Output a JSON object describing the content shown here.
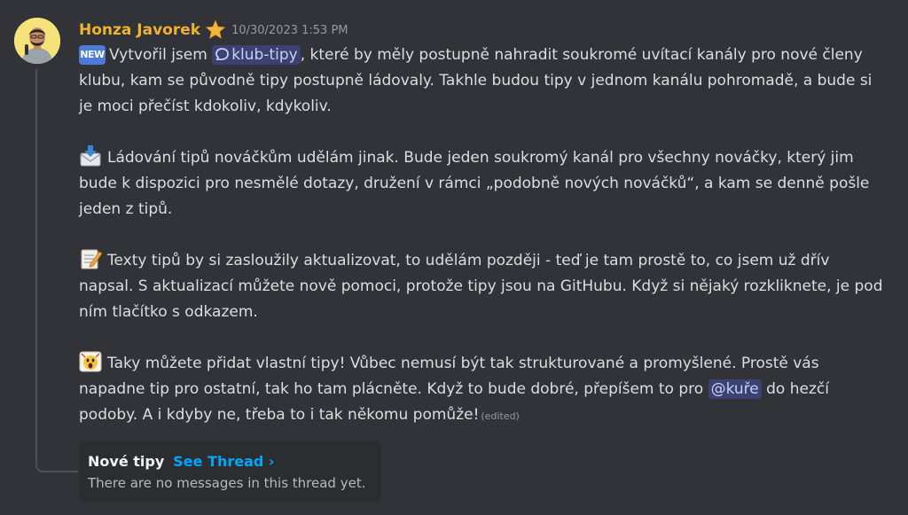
{
  "author": {
    "name": "Honza Javorek",
    "badge_icon": "star-icon",
    "timestamp": "10/30/2023 1:53 PM",
    "name_color": "#f0b232"
  },
  "paragraphs": [
    {
      "icon": "new-icon",
      "badge_text": "NEW",
      "before": "Vytvořil jsem ",
      "mention": "klub-tipy",
      "mention_icon": "thread-channel-icon",
      "after": ", které by měly postupně nahradit soukromé uvítací kanály pro nové členy klubu, kam se původně tipy postupně ládovaly. Takhle budou tipy v jednom kanálu pohromadě, a bude si je moci přečíst kdokoliv, kdykoliv."
    },
    {
      "icon": "envelope-with-arrow-icon",
      "text": "Ládování tipů nováčkům udělám jinak. Bude jeden soukromý kanál pro všechny nováčky, který jim bude k dispozici pro nesmělé dotazy, družení v rámci „podobně nových nováčků“, a kam se denně pošle jeden z tipů."
    },
    {
      "icon": "memo-icon",
      "text": "Texty tipů by si zasloužily aktualizovat, to udělám později - teď je tam prostě to, co jsem už dřív napsal. S aktualizací můžete nově pomoci, protože tipy jsou na GitHubu. Když si nějaký rozkliknete, je pod ním tlačítko s odkazem."
    },
    {
      "icon": "scream-icon",
      "before": "Taky můžete přidat vlastní tipy! Vůbec nemusí být tak strukturované a promyšlené. Prostě vás napadne tip pro ostatní, tak ho tam plácněte. Když to bude dobré, přepíšem to pro ",
      "mention": "@kuře",
      "after": " do hezčí podoby. A i kdyby ne, třeba to i tak někomu pomůže!",
      "edited": "(edited)"
    }
  ],
  "thread": {
    "name": "Nové tipy",
    "link": "See Thread ›",
    "empty_text": "There are no messages in this thread yet."
  },
  "colors": {
    "background": "#313338",
    "mention_bg": "#3c4270",
    "link": "#00a8fc"
  }
}
